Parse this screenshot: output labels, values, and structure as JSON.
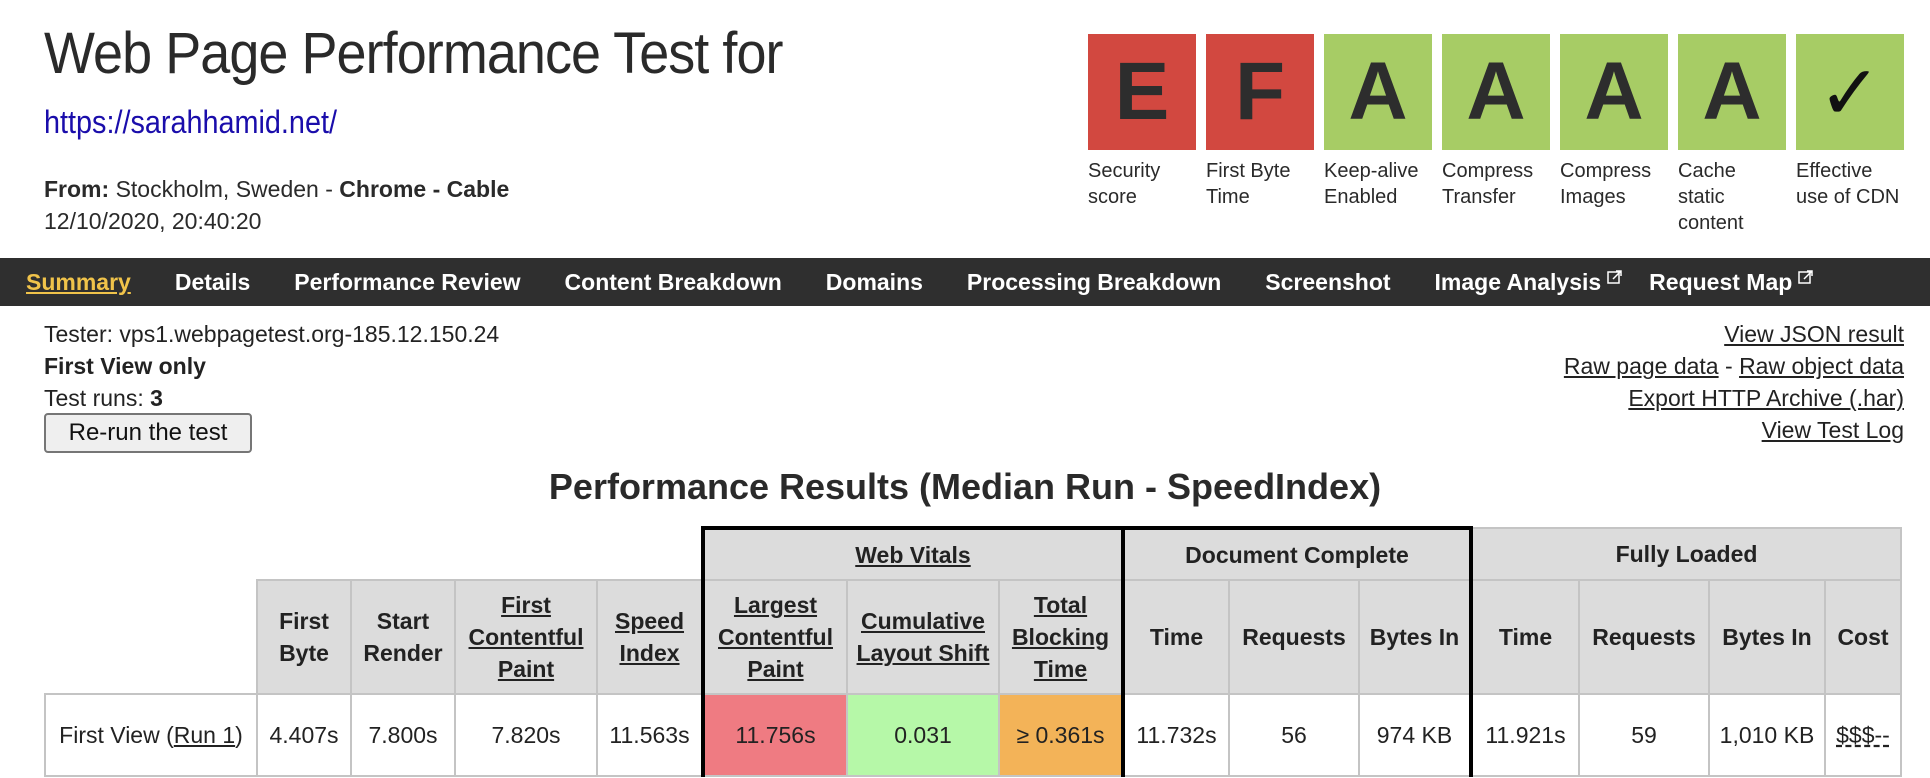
{
  "header": {
    "title": "Web Page Performance Test for",
    "url": "https://sarahhamid.net/",
    "from_label": "From:",
    "location": "Stockholm, Sweden",
    "separator": " - ",
    "browser": "Chrome",
    "connection": "Cable",
    "date": "12/10/2020, 20:40:20"
  },
  "grades": [
    {
      "grade": "E",
      "label": "Security score",
      "color": "#d24840"
    },
    {
      "grade": "F",
      "label": "First Byte Time",
      "color": "#d24840"
    },
    {
      "grade": "A",
      "label": "Keep-alive Enabled",
      "color": "#a7cc65"
    },
    {
      "grade": "A",
      "label": "Compress Transfer",
      "color": "#a7cc65"
    },
    {
      "grade": "A",
      "label": "Compress Images",
      "color": "#a7cc65"
    },
    {
      "grade": "A",
      "label": "Cache static content",
      "color": "#a7cc65"
    },
    {
      "grade": "✓",
      "label": "Effective use of CDN",
      "color": "#a7cc65",
      "icon": "checkmark-icon"
    }
  ],
  "nav": {
    "items": [
      {
        "label": "Summary",
        "active": true
      },
      {
        "label": "Details"
      },
      {
        "label": "Performance Review"
      },
      {
        "label": "Content Breakdown"
      },
      {
        "label": "Domains"
      },
      {
        "label": "Processing Breakdown"
      },
      {
        "label": "Screenshot"
      },
      {
        "label": "Image Analysis",
        "external": true
      },
      {
        "label": "Request Map",
        "external": true
      }
    ],
    "active_color": "#f0c34a",
    "background": "#2f2f2f"
  },
  "info": {
    "tester_label": "Tester:",
    "tester": "vps1.webpagetest.org-185.12.150.24",
    "view_mode": "First View only",
    "runs_label": "Test runs:",
    "runs": "3",
    "rerun_button": "Re-run the test"
  },
  "links": {
    "view_json": "View JSON result",
    "raw_page": "Raw page data",
    "dash": " - ",
    "raw_object": "Raw object data",
    "export_har": "Export HTTP Archive (.har)",
    "view_log": "View Test Log"
  },
  "results": {
    "title": "Performance Results (Median Run - SpeedIndex)",
    "groups": {
      "web_vitals": "Web Vitals",
      "document_complete": "Document Complete",
      "fully_loaded": "Fully Loaded"
    },
    "columns": {
      "first_byte": "First Byte",
      "start_render": "Start Render",
      "fcp": "First Contentful Paint",
      "speed_index": "Speed Index",
      "lcp": "Largest Contentful Paint",
      "cls": "Cumulative Layout Shift",
      "tbt": "Total Blocking Time",
      "dc_time": "Time",
      "dc_requests": "Requests",
      "dc_bytes": "Bytes In",
      "fl_time": "Time",
      "fl_requests": "Requests",
      "fl_bytes": "Bytes In",
      "cost": "Cost"
    },
    "row": {
      "label_prefix": "First View (",
      "run_link": "Run 1",
      "label_suffix": ")",
      "first_byte": "4.407s",
      "start_render": "7.800s",
      "fcp": "7.820s",
      "speed_index": "11.563s",
      "lcp": "11.756s",
      "cls": "0.031",
      "tbt": "≥ 0.361s",
      "dc_time": "11.732s",
      "dc_requests": "56",
      "dc_bytes": "974 KB",
      "fl_time": "11.921s",
      "fl_requests": "59",
      "fl_bytes": "1,010 KB",
      "cost": "$$$--"
    },
    "status_colors": {
      "lcp": "#ef7b82",
      "cls": "#b6f8a8",
      "tbt": "#f3b358"
    }
  }
}
